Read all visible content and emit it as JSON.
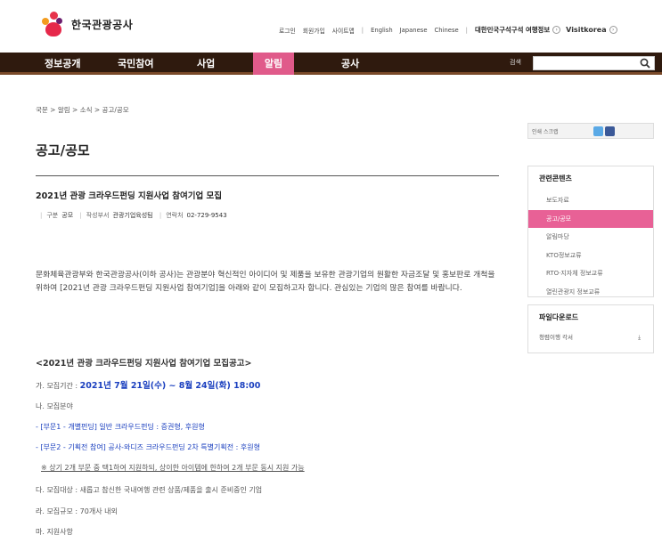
{
  "header": {
    "logo_text": "한국관광공사",
    "util_links": [
      "로그인",
      "회원가입",
      "사이트맵",
      "English",
      "Japanese",
      "Chinese"
    ],
    "kr_link": "대한민국구석구석 여행정보",
    "visitkorea": "Visitkorea"
  },
  "nav": {
    "items": [
      "정보공개",
      "국민참여",
      "사업",
      "알림",
      "공사"
    ],
    "active_index": 3,
    "search_label": "검색",
    "search_value": ""
  },
  "breadcrumb": "국문 > 알림 > 소식 > 공고/공모",
  "page_title": "공고/공모",
  "post": {
    "title": "2021년 관광 크라우드펀딩 지원사업 참여기업 모집",
    "meta": {
      "category_label": "구분",
      "category": "공모",
      "dept_label": "작성부서",
      "dept": "관광기업육성팀",
      "contact_label": "연락처",
      "contact": "02-729-9543"
    },
    "intro": "문화체육관광부와 한국관광공사(이하 공사)는 관광분야 혁신적인 아이디어 및 제품을 보유한 관광기업의 원활한 자금조달 및 홍보판로 개척을 위하여 [2021년 관광 크라우드펀딩 지원사업 참여기업]을 아래와 같이 모집하고자 합니다. 관심있는 기업의 많은 참여를 바랍니다.",
    "notice_head": "<2021년 관광 크라우드펀딩 지원사업 참여기업 모집공고>",
    "period_label": "가. 모집기간 :",
    "period": "2021년 7월 21일(수) ~ 8월 24일(화) 18:00",
    "field_label": "나. 모집분야",
    "field1": "- [부문1 - 개별펀딩] 일반 크라우드펀딩 : 증권형, 후원형",
    "field2": "- [부문2 - 기획전 참여] 공사-와디즈 크라우드펀딩 2차 특별기획전 : 후원형",
    "field_note": "※ 상기 2개 부문 중 택1하여 지원하되, 상이한 아이템에 한하여 2개 부문 동시 지원 가능",
    "target": "다. 모집대상 : 새롭고 참신한 국내여행 관련 상품/제품을 출시 준비중인 기업",
    "scale": "라. 모집규모 : 70개사 내외",
    "support": "마. 지원사항"
  },
  "sidebar": {
    "tools_label": "인쇄  스크랩",
    "related_title": "관련콘텐츠",
    "related_items": [
      "보도자료",
      "공고/공모",
      "알림마당",
      "KTO정보교류",
      "RTO·지자체 정보교류",
      "열린관광지 정보교류"
    ],
    "active_index": 1,
    "download_title": "파일다운로드",
    "download_file": "청렴이행 각서",
    "download_icon": "download-icon"
  }
}
